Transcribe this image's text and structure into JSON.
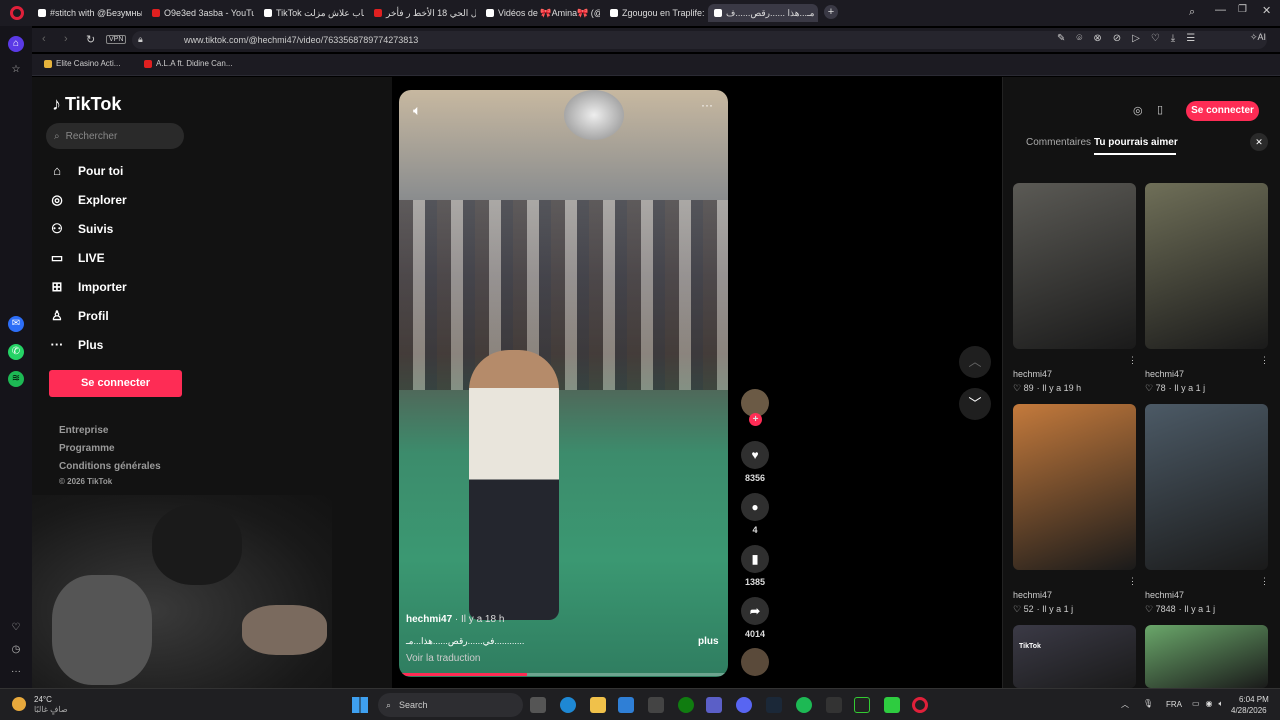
{
  "browser": {
    "tabs": [
      {
        "title": "#stitch with @Безумный",
        "type": "tt",
        "active": false
      },
      {
        "title": "O9e3ed 3asba - YouTube",
        "type": "yt",
        "active": false
      },
      {
        "title": "TikTok أسباب علاش مزلت",
        "type": "tt",
        "active": false
      },
      {
        "title": "داخل الحي 18 الأخط ر فأخر",
        "type": "yt",
        "active": false
      },
      {
        "title": "Vidéos de 🎀Amina🎀 (@",
        "type": "tt",
        "active": false
      },
      {
        "title": "Zgougou en Traplife: Mon",
        "type": "tt",
        "active": false
      },
      {
        "title": "مـ...هذا ......رقص......ف",
        "type": "tt",
        "active": true
      }
    ],
    "new_tab": "+",
    "url": "www.tiktok.com/@hechmi47/video/7633568789774273813",
    "vpn": "VPN",
    "ai_label": "AI",
    "bookmarks": [
      "Elite Casino Acti...",
      "A.L.A ft. Didine Can..."
    ]
  },
  "tiktok": {
    "logo": "TikTok",
    "search_placeholder": "Rechercher",
    "nav": [
      {
        "label": "Pour toi",
        "icon": "home-icon",
        "glyph": "⌂"
      },
      {
        "label": "Explorer",
        "icon": "compass-icon",
        "glyph": "◎"
      },
      {
        "label": "Suivis",
        "icon": "following-icon",
        "glyph": "⚇"
      },
      {
        "label": "LIVE",
        "icon": "live-icon",
        "glyph": "▭"
      },
      {
        "label": "Importer",
        "icon": "upload-icon",
        "glyph": "⊞"
      },
      {
        "label": "Profil",
        "icon": "profile-icon",
        "glyph": "♙"
      },
      {
        "label": "Plus",
        "icon": "more-icon",
        "glyph": "···"
      }
    ],
    "login_button": "Se connecter",
    "footer": [
      "Entreprise",
      "Programme",
      "Conditions générales",
      "© 2026 TikTok"
    ],
    "video": {
      "author": "hechmi47",
      "time": "· Il y a 18 h",
      "caption": "في......رقص......هذا...مـ............",
      "translate": "Voir la traduction",
      "more": "plus",
      "progress": 0.39
    },
    "actions": {
      "likes": "8356",
      "comments": "4",
      "saves": "1385",
      "shares": "4014"
    },
    "right": {
      "login_button": "Se connecter",
      "tab_comments": "Commentaires",
      "tab_suggest": "Tu pourrais aimer",
      "items": [
        {
          "user": "hechmi47",
          "likes": "89",
          "time": "· Il y a 19 h",
          "bg": "#5b5a55"
        },
        {
          "user": "hechmi47",
          "likes": "78",
          "time": "· Il y a 1 j",
          "bg": "#6f6f58"
        },
        {
          "user": "hechmi47",
          "likes": "52",
          "time": "· Il y a 1 j",
          "bg": "#c47a3c"
        },
        {
          "user": "hechmi47",
          "likes": "7848",
          "time": "· Il y a 1 j",
          "bg": "#4c5a66"
        },
        {
          "user": "",
          "likes": "",
          "time": "",
          "bg": "#3b3a46",
          "tag": "TikTok"
        },
        {
          "user": "",
          "likes": "",
          "time": "",
          "bg": "#6aa76a"
        }
      ]
    }
  },
  "taskbar": {
    "weather_temp": "24°C",
    "weather_text": "صافٍ غالبًا",
    "search": "Search",
    "lang": "FRA",
    "time": "6:04 PM",
    "date": "4/28/2026"
  }
}
